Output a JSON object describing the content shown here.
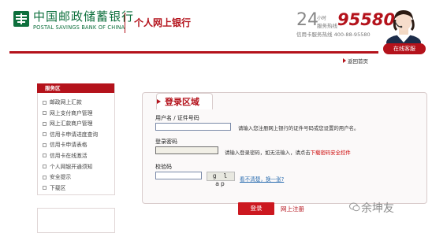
{
  "header": {
    "bank_name_cn": "中国邮政储蓄银行",
    "bank_name_en": "POSTAL SAVINGS BANK OF CHINA",
    "page_title": "个人网上银行",
    "hours_number": "24",
    "hours_sub1": "小时",
    "hours_sub2": "服务热线",
    "hotline": "95580",
    "credit_card_hotline": "信用卡服务热线 400-88-95580",
    "online_service_label": "在线客服",
    "home_link": "返回首页"
  },
  "sidebar": {
    "title": "服务区",
    "items": [
      "邮政网上汇款",
      "网上支付商户管理",
      "网上汇款商户管理",
      "信用卡申请进度查询",
      "信用卡申请表格",
      "信用卡在线激活",
      "个人网银开通须知",
      "安全提示",
      "下载区"
    ]
  },
  "login": {
    "tab_title": "登录区域",
    "username_label": "用户名 / 证件号码",
    "username_hint": "请输入您注册网上银行的证件号码或您设置的用户名。",
    "password_label": "登录密码",
    "password_hint_prefix": "请输入登录密码，如无法输入，请点击",
    "password_hint_link": "下载密码安全控件",
    "captcha_label": "校验码",
    "captcha_text": "g l ap",
    "refresh_link": "看不清楚，换一张?",
    "login_button": "登录",
    "register_link": "网上注册"
  },
  "watermark": "余坤友",
  "colors": {
    "brand_green": "#0d6f3c",
    "brand_red": "#b4121b",
    "button_red": "#cc1820"
  }
}
